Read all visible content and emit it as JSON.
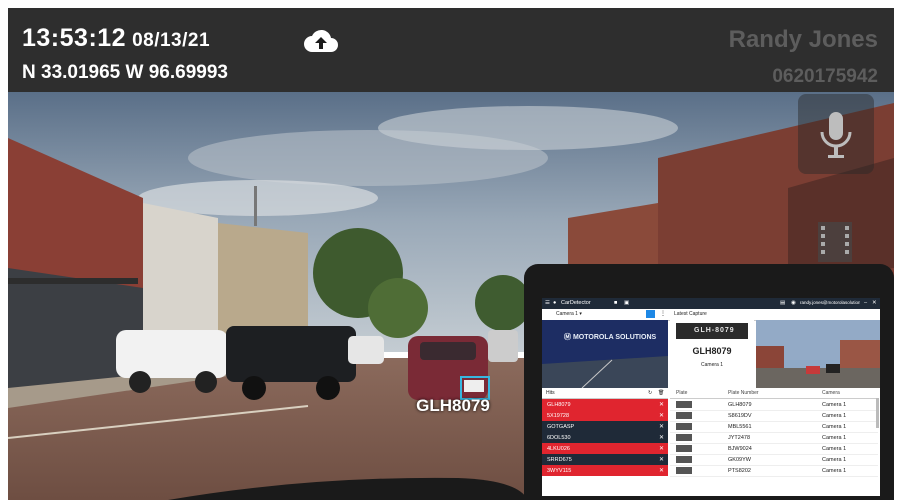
{
  "hud": {
    "time": "13:53:12",
    "date": "08/13/21",
    "coords": "N 33.01965 W 96.69993",
    "user_name": "Randy Jones",
    "badge_id": "0620175942",
    "upload_icon": "cloud-upload-icon",
    "mic_icon": "microphone-icon",
    "video_icon": "film-strip-icon"
  },
  "scene": {
    "detected_plate": "GLH8079"
  },
  "tablet_app": {
    "app_name": "CarDetector",
    "user_email": "randy.jones@motorolasolutions.com",
    "camera_select": "Camera 1",
    "banner_logo": "MOTOROLA SOLUTIONS",
    "latest_capture_label": "Latest Capture",
    "capture_plate_image_text": "GLH-8079",
    "capture_plate": "GLH8079",
    "capture_camera": "Camera 1",
    "hits_label": "Hits",
    "hits": [
      {
        "plate": "GLH8079",
        "alert": true
      },
      {
        "plate": "5X19728",
        "alert": true
      },
      {
        "plate": "GOTGASP",
        "alert": false
      },
      {
        "plate": "6DOL530",
        "alert": false
      },
      {
        "plate": "4LKU026",
        "alert": true
      },
      {
        "plate": "SRRD675",
        "alert": false
      },
      {
        "plate": "3WYV115",
        "alert": true
      }
    ],
    "table_headers": {
      "plate": "Plate",
      "plate_number": "Plate Number",
      "camera": "Camera"
    },
    "table_rows": [
      {
        "plate_number": "GLH8079",
        "camera": "Camera 1"
      },
      {
        "plate_number": "S8619DV",
        "camera": "Camera 1"
      },
      {
        "plate_number": "MBL5561",
        "camera": "Camera 1"
      },
      {
        "plate_number": "JYT2478",
        "camera": "Camera 1"
      },
      {
        "plate_number": "BJW9024",
        "camera": "Camera 1"
      },
      {
        "plate_number": "GK09YW",
        "camera": "Camera 1"
      },
      {
        "plate_number": "PTS8202",
        "camera": "Camera 1"
      }
    ]
  },
  "colors": {
    "hit_alert": "#e0252f",
    "hit_normal": "#1f2a38",
    "accent": "#37b7e0"
  }
}
